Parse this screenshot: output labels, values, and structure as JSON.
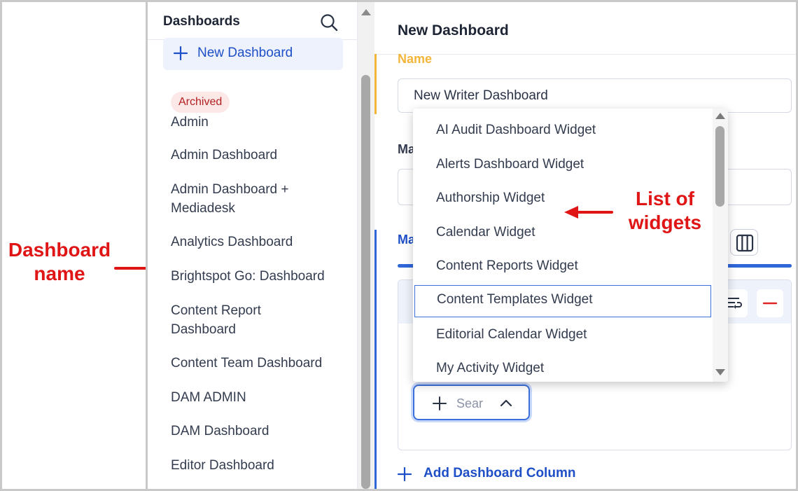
{
  "annotations": {
    "dashboard_name": "Dashboard\nname",
    "dashboard_name_line1": "Dashboard",
    "dashboard_name_line2": "name",
    "list_of_widgets_line1": "List of",
    "list_of_widgets_line2": "widgets",
    "color": "#e01515"
  },
  "sidebar": {
    "title": "Dashboards",
    "search_icon": "search-icon",
    "new_dashboard_label": "New Dashboard",
    "archived_badge": "Archived",
    "items": [
      {
        "label": "Admin"
      },
      {
        "label": "Admin Dashboard"
      },
      {
        "label": "Admin Dashboard + Mediadesk"
      },
      {
        "label": "Analytics Dashboard"
      },
      {
        "label": "Brightspot Go: Dashboard"
      },
      {
        "label": "Content Report Dashboard"
      },
      {
        "label": "Content Team Dashboard"
      },
      {
        "label": "DAM ADMIN"
      },
      {
        "label": "DAM Dashboard"
      },
      {
        "label": "Editor Dashboard"
      }
    ]
  },
  "main": {
    "title": "New Dashboard",
    "name_label": "Name",
    "name_value": "New Writer Dashboard",
    "ma_label": "Ma",
    "ma2_label": "Ma",
    "search_placeholder": "Sear",
    "add_column_label": "Add Dashboard Column"
  },
  "dropdown": {
    "items": [
      {
        "label": "AI Audit Dashboard Widget"
      },
      {
        "label": "Alerts Dashboard Widget"
      },
      {
        "label": "Authorship Widget"
      },
      {
        "label": "Calendar Widget"
      },
      {
        "label": "Content Reports Widget"
      },
      {
        "label": "Content Templates Widget",
        "highlighted": true
      },
      {
        "label": "Editorial Calendar Widget"
      },
      {
        "label": "My Activity Widget"
      }
    ]
  },
  "colors": {
    "accent_blue": "#1e4fc7",
    "name_label_yellow": "#f4b63a",
    "archived_badge_bg": "#fde8e8",
    "archived_badge_text": "#b32020",
    "minus_red": "#e02424"
  }
}
